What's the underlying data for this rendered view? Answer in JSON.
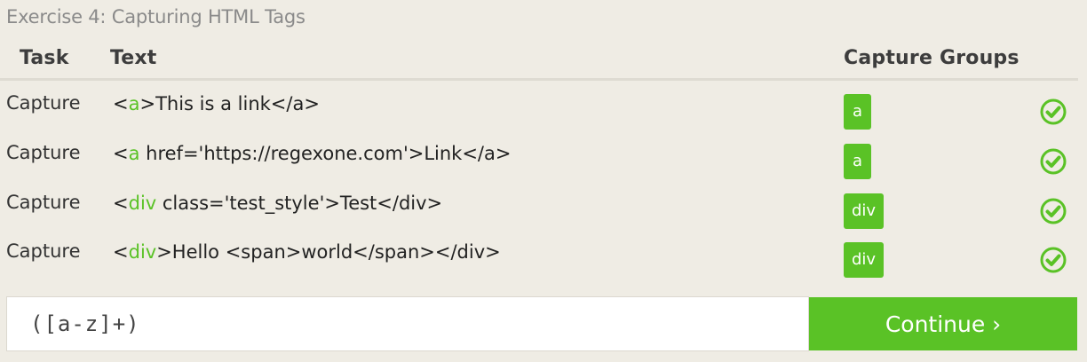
{
  "exercise": {
    "title": "Exercise 4: Capturing HTML Tags"
  },
  "table": {
    "headers": {
      "task": "Task",
      "text": "Text",
      "groups": "Capture Groups"
    },
    "rows": [
      {
        "task": "Capture",
        "text_prefix": "<",
        "text_match": "a",
        "text_suffix": ">This is a link</a>",
        "group": "a",
        "status": "check-icon"
      },
      {
        "task": "Capture",
        "text_prefix": "<",
        "text_match": "a",
        "text_suffix": " href='https://regexone.com'>Link</a>",
        "group": "a",
        "status": "check-icon"
      },
      {
        "task": "Capture",
        "text_prefix": "<",
        "text_match": "div",
        "text_suffix": " class='test_style'>Test</div>",
        "group": "div",
        "status": "check-icon"
      },
      {
        "task": "Capture",
        "text_prefix": "<",
        "text_match": "div",
        "text_suffix": ">Hello <span>world</span></div>",
        "group": "div",
        "status": "check-icon"
      }
    ]
  },
  "input": {
    "value": "([a-z]+)"
  },
  "continue_button": {
    "label": "Continue ›"
  },
  "colors": {
    "accent": "#5ac226",
    "background": "#efece4"
  }
}
